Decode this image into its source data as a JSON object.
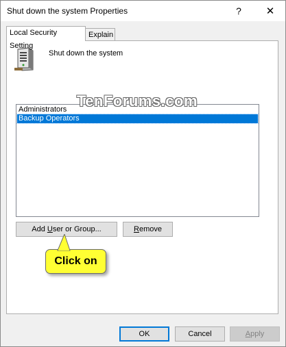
{
  "window": {
    "title": "Shut down the system Properties",
    "help_label": "?",
    "close_label": "✕"
  },
  "tabs": [
    {
      "label": "Local Security Setting"
    },
    {
      "label": "Explain"
    }
  ],
  "setting": {
    "name": "Shut down the system",
    "icon": "server-icon"
  },
  "list": {
    "items": [
      {
        "label": "Administrators",
        "selected": false
      },
      {
        "label": "Backup Operators",
        "selected": true
      }
    ]
  },
  "buttons": {
    "add_prefix": "Add ",
    "add_accel": "U",
    "add_suffix": "ser or Group...",
    "remove_accel": "R",
    "remove_suffix": "emove",
    "ok": "OK",
    "cancel": "Cancel",
    "apply_accel": "A",
    "apply_suffix": "pply"
  },
  "annotation": {
    "callout_text": "Click on",
    "watermark": "TenForums.com"
  },
  "colors": {
    "selection": "#0078d7",
    "callout": "#ffff33"
  }
}
